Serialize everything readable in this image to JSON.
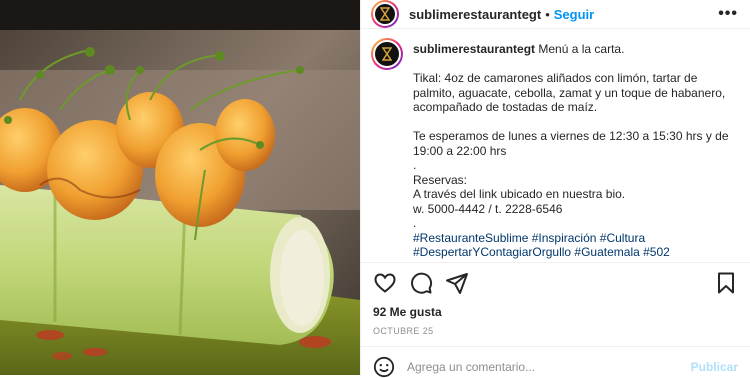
{
  "header": {
    "username": "sublimerestaurantegt",
    "separator": "•",
    "follow_label": "Seguir",
    "more_label": "•••"
  },
  "caption": {
    "username": "sublimerestaurantegt",
    "lines": [
      " Menú a la carta.",
      "",
      "Tikal: 4oz de camarones aliñados con limón, tartar de palmito, aguacate, cebolla, zamat y un toque de habanero, acompañado de tostadas de maíz.",
      "",
      "Te esperamos de lunes a viernes de 12:30 a 15:30 hrs y de 19:00 a 22:00 hrs",
      ".",
      "Reservas:",
      "A través del link ubicado en nuestra bio.",
      "w. 5000-4442 / t. 2228-6546",
      "."
    ],
    "hashtags_line1": "#RestauranteSublime #Inspiración #Cultura",
    "hashtags_line2": "#DespertarYContagiarOrgullo #Guatemala #502"
  },
  "actions": {
    "like_icon": "heart-icon",
    "comment_icon": "comment-icon",
    "share_icon": "share-icon",
    "save_icon": "bookmark-icon"
  },
  "likes_text": "92 Me gusta",
  "date_text": "OCTUBRE 25",
  "comment": {
    "placeholder": "Agrega un comentario...",
    "publish_label": "Publicar",
    "emoji_icon": "smiley-icon"
  },
  "colors": {
    "accent": "#0095f6",
    "hashtag": "#00376b",
    "publish_disabled": "#b2dffc"
  }
}
